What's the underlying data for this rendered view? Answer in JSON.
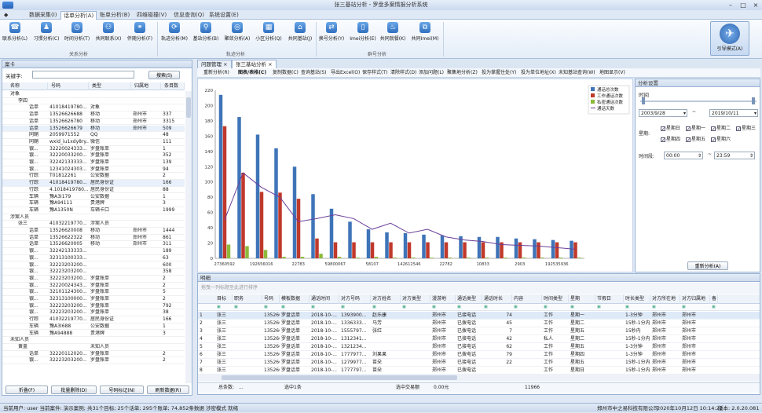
{
  "app": {
    "title": "张三基站分析 - 罗盘多案情报分析系统"
  },
  "menu": {
    "items": [
      "数据采集(I)",
      "话单分析(A)",
      "账单分析(B)",
      "四维碰撞(V)",
      "信息查询(Q)",
      "系统设置(E)"
    ],
    "active": 1
  },
  "ribbon": {
    "groups": [
      "关系分析",
      "轨迹分析",
      "群号分析"
    ],
    "buttons": [
      "联系分析(L)",
      "习惯分析(C)",
      "时间分析(T)",
      "共同联系(X)",
      "伴随分析(F)",
      "轨迹分析(M)",
      "基站分析(B)",
      "聚敛分析(A)",
      "小区分析(Q)",
      "共同基站(J)",
      "换号分析(Y)",
      "Imei分析(E)",
      "共同就餐(K)",
      "共同Imei(M)"
    ],
    "big_button": "引导模式(A)"
  },
  "left": {
    "title": "案卡",
    "keyword_label": "关键字:",
    "keyword_value": "",
    "search_button": "搜索(S)",
    "columns": [
      "名称",
      "号码",
      "类型",
      "归属地",
      "条目数"
    ],
    "rows": [
      [
        "对象",
        "",
        "",
        "",
        ""
      ],
      [
        "李四",
        "",
        "",
        "",
        ""
      ],
      [
        "话单",
        "41018419780...",
        "对象",
        "",
        ""
      ],
      [
        "话单",
        "13526626688",
        "移动",
        "郑州市",
        "337"
      ],
      [
        "话单",
        "13526626780",
        "移动",
        "郑州市",
        "3315"
      ],
      [
        "话单",
        "13526626679",
        "移动",
        "郑州市",
        "509"
      ],
      [
        "同鞘",
        "2059971552",
        "QQ",
        "",
        "48"
      ],
      [
        "同鞘",
        "wxid_iu1xdy8ry...",
        "微信",
        "",
        "111"
      ],
      [
        "银...",
        "32220024333...",
        "罗盘账单",
        "",
        "1"
      ],
      [
        "银...",
        "32220033200...",
        "罗盘账单",
        "",
        "352"
      ],
      [
        "银...",
        "32242133333...",
        "罗盘账单",
        "",
        "139"
      ],
      [
        "银...",
        "12341024303...",
        "罗盘账单",
        "",
        "94"
      ],
      [
        "行踪",
        "T01812261",
        "公安数据",
        "",
        "2"
      ],
      [
        "行踪",
        "41018419780...",
        "居民身份证",
        "",
        "166"
      ],
      [
        "行踪",
        "4.1018419780...",
        "居民身份证",
        "",
        "88"
      ],
      [
        "车辆",
        "豫A3I179",
        "公安数据",
        "",
        "1"
      ],
      [
        "车辆",
        "豫A94111",
        "贵港牌",
        "",
        "3"
      ],
      [
        "车辆",
        "豫A1350N",
        "车辆卡口",
        "",
        "1999"
      ],
      [
        "涉案人员",
        "",
        "",
        "",
        ""
      ],
      [
        "张三",
        "41032219770...",
        "涉案人员",
        "",
        ""
      ],
      [
        "话单",
        "13526620008",
        "移动",
        "郑州市",
        "1444"
      ],
      [
        "话单",
        "13526622322",
        "移动",
        "郑州市",
        "861"
      ],
      [
        "话单",
        "13526620005",
        "移动",
        "郑州市",
        "311"
      ],
      [
        "银...",
        "32242133333...",
        "",
        "",
        "189"
      ],
      [
        "银...",
        "32313100333...",
        "",
        "",
        "63"
      ],
      [
        "银...",
        "32223203200...",
        "",
        "",
        "600"
      ],
      [
        "银...",
        "32223203200...",
        "",
        "",
        "358"
      ],
      [
        "银...",
        "32223203200...",
        "罗盘账单",
        "",
        "2"
      ],
      [
        "银...",
        "32220024343...",
        "罗盘账单",
        "",
        "2"
      ],
      [
        "银...",
        "32101124300...",
        "罗盘账单",
        "",
        "5"
      ],
      [
        "银...",
        "32313100000...",
        "罗盘账单",
        "",
        "2"
      ],
      [
        "银...",
        "32223203200...",
        "罗盘账单",
        "",
        "792"
      ],
      [
        "银...",
        "32223203200...",
        "罗盘账单",
        "",
        "38"
      ],
      [
        "行踪",
        "41032219770...",
        "居民身份证",
        "",
        "166"
      ],
      [
        "车辆",
        "豫A3I688",
        "公安数据",
        "",
        "1"
      ],
      [
        "车辆",
        "豫A94888",
        "贵港牌",
        "",
        "3"
      ],
      [
        "未知人员",
        "",
        "",
        "",
        ""
      ],
      [
        "黄盖",
        "",
        "未知人员",
        "",
        ""
      ],
      [
        "话单",
        "32220112020...",
        "罗盘账单",
        "",
        "2"
      ],
      [
        "银...",
        "32223203200...",
        "罗盘账单",
        "",
        "2"
      ]
    ],
    "buttons": [
      "折叠(F)",
      "批量删除(D)",
      "号码标记(N)",
      "刷新数据(R)"
    ]
  },
  "doc_tabs": [
    "问题管理",
    "张三基站分析"
  ],
  "toolbar": [
    "重新分析(R)",
    "图表/表格(C)",
    "复制数据(C)",
    "查询基站(S)",
    "导出Excel(O)",
    "保存样式(T)",
    "清除样式(D)",
    "添加问题(L)",
    "聚集地分析(Z)",
    "投为掌握住处(Y)",
    "投为单位地址(X)",
    "未知基站查询(W)",
    "地图显示(V)"
  ],
  "chart_data": {
    "type": "bar",
    "categories": [
      "27360592",
      "",
      "192656016",
      "",
      "22783",
      "",
      "59800067",
      "",
      "58107",
      "",
      "142612546",
      "",
      "22782",
      "",
      "10833",
      "",
      "2903",
      "",
      "192535936",
      ""
    ],
    "series": [
      {
        "name": "通话总次数",
        "color": "#3f74b8",
        "values": [
          214,
          185,
          162,
          144,
          120,
          84,
          65,
          48,
          38,
          34,
          33,
          31,
          30,
          29,
          28,
          28,
          26,
          25,
          24,
          23
        ]
      },
      {
        "name": "工作通话次数",
        "color": "#c0392b",
        "values": [
          173,
          112,
          87,
          86,
          78,
          26,
          21,
          21,
          21,
          21,
          21,
          21,
          21,
          21,
          21,
          21,
          21,
          21,
          21,
          21
        ]
      },
      {
        "name": "私密通话次数",
        "color": "#8dba3a",
        "values": [
          18,
          16,
          11,
          2,
          2,
          6,
          2,
          1,
          2,
          1,
          1,
          1,
          1,
          1,
          1,
          1,
          1,
          1,
          1,
          1
        ]
      },
      {
        "name": "通话天数",
        "color": "#6a3f99",
        "values": [
          50,
          112,
          93,
          80,
          48,
          52,
          57,
          52,
          38,
          46,
          33,
          38,
          28,
          24,
          22,
          18,
          17,
          16,
          14,
          12
        ]
      }
    ],
    "ylim": [
      0,
      220
    ],
    "yticks": [
      0,
      20,
      40,
      60,
      80,
      100,
      120,
      140,
      160,
      180,
      200,
      220
    ]
  },
  "settings": {
    "title": "分析设置",
    "time_label": "时间",
    "date_from": "2003/9/28",
    "date_to": "2019/10/11",
    "week_label": "星期:",
    "weekdays": [
      "星期日",
      "星期一",
      "星期二",
      "星期三",
      "星期四",
      "星期五",
      "星期六"
    ],
    "time_range_label": "时间段:",
    "time_from": "00:00",
    "time_to": "23:59",
    "analyze_button": "重新分析(A)"
  },
  "grid": {
    "title": "明细",
    "group_hint": "拖曳一列标题至此进行排序",
    "columns": [
      "目标",
      "职务",
      "号码",
      "模板数据",
      "通话时间",
      "对方号码",
      "对方姓名",
      "对方类型",
      "漫游地",
      "通话类型",
      "通话时长",
      "内容",
      "时间类型",
      "星期",
      "节假日",
      "时长类型",
      "对方所在地",
      "对方归属地",
      "备"
    ],
    "rows": [
      [
        "1",
        "张三",
        "",
        "1352662...",
        "罗盘话单",
        "2018-10-...",
        "1393900...",
        "赵乐康",
        "",
        "郑州市",
        "已接电话",
        "74",
        "",
        "工作",
        "星期一",
        "",
        "1-3分钟",
        "郑州市",
        "郑州市"
      ],
      [
        "2",
        "张三",
        "",
        "1352662...",
        "罗盘话单",
        "2018-10-...",
        "1336333...",
        "马芳",
        "",
        "郑州市",
        "已拨电话",
        "45",
        "",
        "工作",
        "星期二",
        "",
        "15秒-1分内",
        "郑州市",
        "郑州市"
      ],
      [
        "3",
        "张三",
        "",
        "1352662...",
        "罗盘话单",
        "2018-10-...",
        "1555797...",
        "张红",
        "",
        "郑州市",
        "已拨电话",
        "7",
        "",
        "工作",
        "星期五",
        "",
        "15秒内",
        "郑州市",
        "郑州市"
      ],
      [
        "4",
        "张三",
        "",
        "1352662...",
        "罗盘话单",
        "2018-10-...",
        "1312341...",
        "",
        "",
        "郑州市",
        "已接电话",
        "42",
        "",
        "私人",
        "星期二",
        "",
        "15秒-1分内",
        "郑州市",
        "郑州市"
      ],
      [
        "5",
        "张三",
        "",
        "1352662...",
        "罗盘话单",
        "2018-10-...",
        "1321234...",
        "",
        "",
        "郑州市",
        "已接电话",
        "62",
        "",
        "工作",
        "星期五",
        "",
        "1-3分钟",
        "郑州市",
        "郑州市"
      ],
      [
        "6",
        "张三",
        "",
        "1352662...",
        "罗盘话单",
        "2018-10-...",
        "1777977...",
        "刘果果",
        "",
        "郑州市",
        "已拨电话",
        "79",
        "",
        "工作",
        "星期四",
        "",
        "1-3分钟",
        "郑州市",
        "郑州市"
      ],
      [
        "7",
        "张三",
        "",
        "1352662...",
        "罗盘话单",
        "2018-10-...",
        "1279977...",
        "苗朵",
        "",
        "郑州市",
        "已接电话",
        "22",
        "",
        "工作",
        "星期五",
        "",
        "15秒-1分内",
        "郑州市",
        "郑州市"
      ],
      [
        "8",
        "张三",
        "",
        "1352662...",
        "罗盘话单",
        "2018-10-...",
        "1777797...",
        "苗朵",
        "",
        "郑州市",
        "已拨电话",
        "",
        "",
        "工作",
        "星期日",
        "",
        "15秒-1分内",
        "郑州市",
        "郑州市"
      ]
    ],
    "footer": {
      "total_label": "总条数:",
      "total_value": "...",
      "selected_label": "选中1条",
      "amount_label": "选中交易额",
      "amount_value": "0.00元",
      "sum_value": "11966"
    }
  },
  "status": {
    "left": "当前用户: user  当前案件: 演示案例; 共31个目标; 25个话单; 295个账单; 74,852条数据  涉密模式  就绪",
    "company": "郑州市中之易科技有限公司",
    "datetime": "2020年10月12日 10:14:22",
    "version": "版本: 2.0.20.081"
  }
}
